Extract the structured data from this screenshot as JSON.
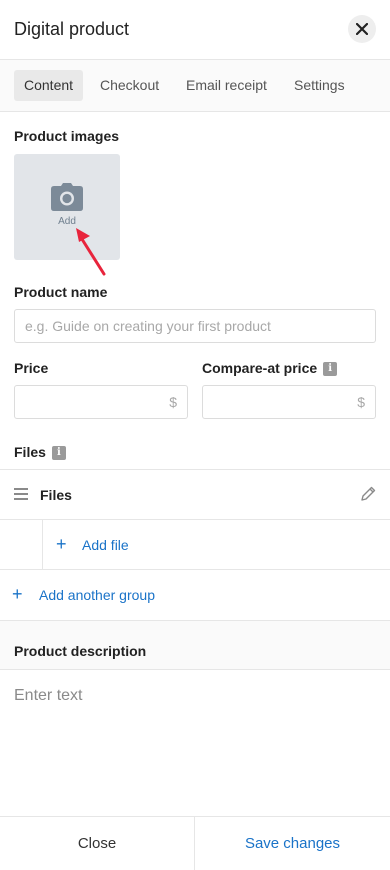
{
  "header": {
    "title": "Digital product"
  },
  "tabs": [
    {
      "label": "Content",
      "active": true
    },
    {
      "label": "Checkout",
      "active": false
    },
    {
      "label": "Email receipt",
      "active": false
    },
    {
      "label": "Settings",
      "active": false
    }
  ],
  "images": {
    "label": "Product images",
    "add_label": "Add"
  },
  "name": {
    "label": "Product name",
    "placeholder": "e.g. Guide on creating your first product",
    "value": ""
  },
  "price": {
    "label": "Price",
    "currency": "$",
    "value": ""
  },
  "compare": {
    "label": "Compare-at price",
    "currency": "$",
    "value": ""
  },
  "files": {
    "label": "Files",
    "group_title": "Files",
    "add_file_label": "Add file",
    "add_group_label": "Add another group"
  },
  "description": {
    "label": "Product description",
    "placeholder": "Enter text"
  },
  "footer": {
    "close_label": "Close",
    "save_label": "Save changes"
  },
  "colors": {
    "accent": "#1a73c8",
    "annotation_arrow": "#e8243c"
  },
  "info_glyph": "i"
}
